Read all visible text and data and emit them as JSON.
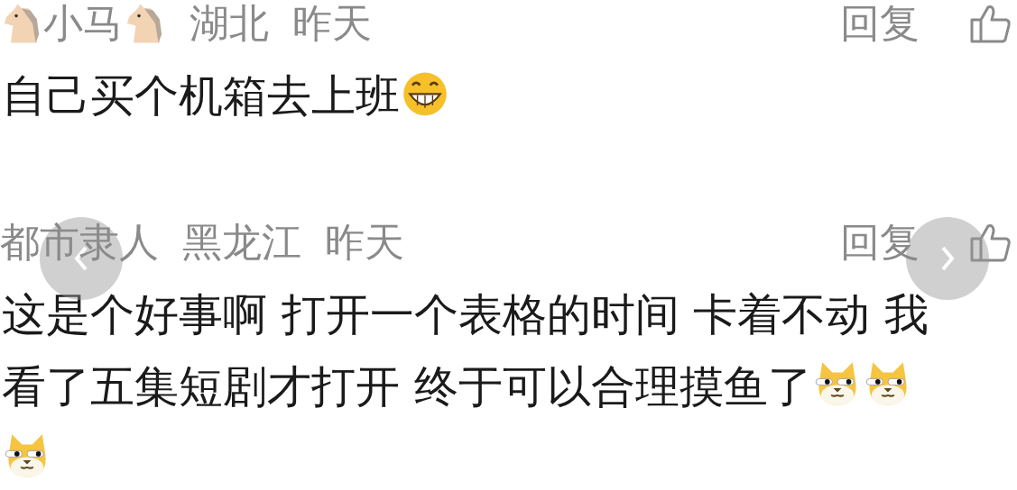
{
  "comments": [
    {
      "author": [
        {
          "kind": "horse"
        },
        {
          "kind": "text",
          "text": "小马"
        },
        {
          "kind": "horse"
        }
      ],
      "region": "湖北",
      "time": "昨天",
      "reply": "回复",
      "body": [
        {
          "kind": "text",
          "text": "自己买个机箱去上班"
        },
        {
          "kind": "grin"
        }
      ]
    },
    {
      "author": [
        {
          "kind": "text",
          "text": "都市隶人"
        }
      ],
      "region": "黑龙江",
      "time": "昨天",
      "reply": "回复",
      "body": [
        {
          "kind": "text",
          "text": "这是个好事啊 打开一个表格的时间 卡着不动 我看了五集短剧才打开 终于可以合理摸鱼了"
        },
        {
          "kind": "doge"
        },
        {
          "kind": "doge"
        },
        {
          "kind": "doge"
        }
      ]
    }
  ]
}
